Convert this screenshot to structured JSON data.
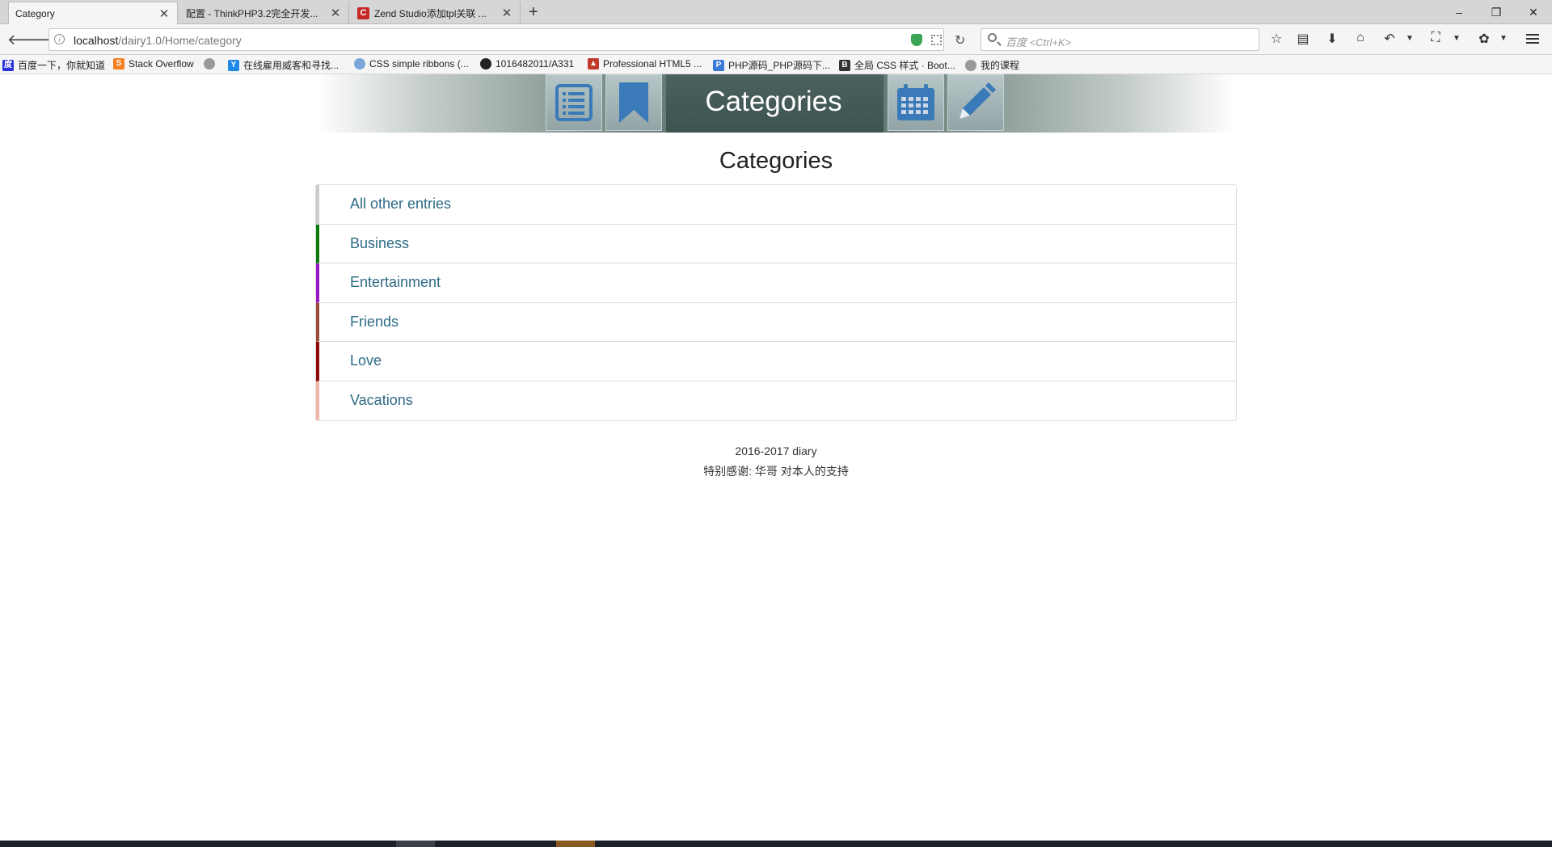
{
  "browser": {
    "tabs": [
      {
        "title": "Category",
        "active": true
      },
      {
        "title": "配置 - ThinkPHP3.2完全开发...",
        "active": false
      },
      {
        "title": "Zend Studio添加tpl关联 ...",
        "active": false
      }
    ],
    "new_tab": "+",
    "window_controls": {
      "minimize": "–",
      "restore": "❐",
      "close": "✕"
    },
    "url_host": "localhost",
    "url_path": "/dairy1.0/Home/category",
    "search_placeholder": "百度 <Ctrl+K>",
    "bookmarks": [
      {
        "label": "百度一下，你就知道",
        "icon": "baidu-icon",
        "color": "#2932e1"
      },
      {
        "label": "Stack Overflow",
        "icon": "stackoverflow-icon",
        "color": "#f48024"
      },
      {
        "label": "",
        "icon": "globe-icon",
        "color": "#999999"
      },
      {
        "label": "在线雇用威客和寻找...",
        "icon": "y-icon",
        "color": "#1e88e5"
      },
      {
        "label": "CSS simple ribbons (...",
        "icon": "cloud-icon",
        "color": "#7aa6d8"
      },
      {
        "label": "1016482011/A331",
        "icon": "github-icon",
        "color": "#222222"
      },
      {
        "label": "Professional HTML5 ...",
        "icon": "triangle-icon",
        "color": "#c0392b"
      },
      {
        "label": "PHP源码_PHP源码下...",
        "icon": "php-icon",
        "color": "#3a7bd5"
      },
      {
        "label": "全局 CSS 样式 · Boot...",
        "icon": "bootstrap-icon",
        "color": "#333333"
      },
      {
        "label": "我的课程",
        "icon": "globe-icon",
        "color": "#999999"
      }
    ]
  },
  "banner": {
    "title": "Categories",
    "icons": [
      "list-icon",
      "bookmark-icon",
      "calendar-icon",
      "pencil-icon"
    ],
    "accent": "#3a7ab8"
  },
  "page": {
    "heading": "Categories",
    "categories": [
      {
        "label": "All other entries",
        "color": "#cccccc"
      },
      {
        "label": "Business",
        "color": "#0a7a0a"
      },
      {
        "label": "Entertainment",
        "color": "#9b17c7"
      },
      {
        "label": "Friends",
        "color": "#9a4a3c"
      },
      {
        "label": "Love",
        "color": "#8b0a0a"
      },
      {
        "label": "Vacations",
        "color": "#f0b5a8"
      }
    ],
    "footer": {
      "line1": "2016-2017 diary",
      "line2": "特别感谢: 华哥 对本人的支持"
    }
  }
}
